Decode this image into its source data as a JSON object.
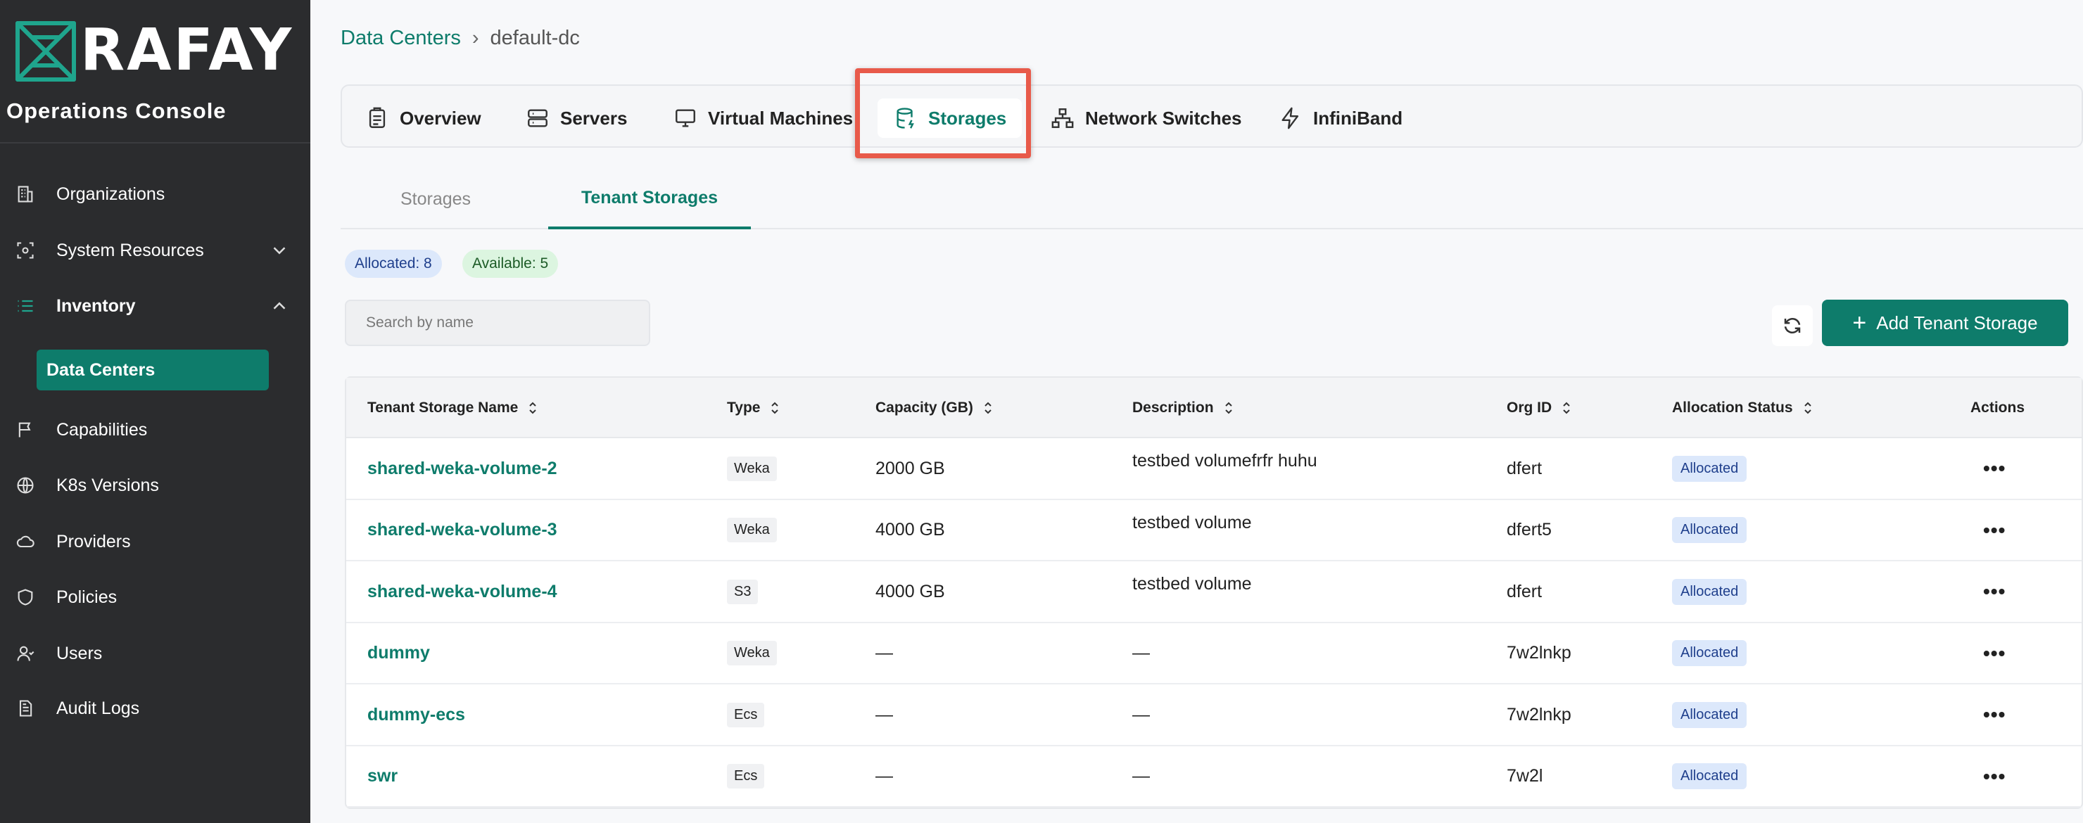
{
  "sidebar": {
    "brand": "RAFAY",
    "console_title": "Operations Console",
    "items": [
      {
        "label": "Organizations",
        "icon": "building-icon"
      },
      {
        "label": "System Resources",
        "icon": "scan-icon"
      },
      {
        "label": "Inventory",
        "icon": "list-icon"
      },
      {
        "label": "Data Centers"
      },
      {
        "label": "Capabilities",
        "icon": "flag-icon"
      },
      {
        "label": "K8s Versions",
        "icon": "globe-icon"
      },
      {
        "label": "Providers",
        "icon": "cloud-icon"
      },
      {
        "label": "Policies",
        "icon": "shield-icon"
      },
      {
        "label": "Users",
        "icon": "user-icon"
      },
      {
        "label": "Audit Logs",
        "icon": "document-icon"
      }
    ]
  },
  "breadcrumb": {
    "parent": "Data Centers",
    "separator": "›",
    "current": "default-dc"
  },
  "tabs": [
    {
      "label": "Overview",
      "icon": "clipboard-icon"
    },
    {
      "label": "Servers",
      "icon": "server-icon"
    },
    {
      "label": "Virtual Machines",
      "icon": "monitor-icon"
    },
    {
      "label": "Storages",
      "icon": "database-icon"
    },
    {
      "label": "Network Switches",
      "icon": "network-icon"
    },
    {
      "label": "InfiniBand",
      "icon": "lightning-icon"
    }
  ],
  "active_tab": "Storages",
  "subtabs": [
    {
      "label": "Storages"
    },
    {
      "label": "Tenant Storages"
    }
  ],
  "summary": {
    "allocated": "Allocated: 8",
    "available": "Available: 5"
  },
  "search": {
    "placeholder": "Search by name"
  },
  "add_button": {
    "label": "Add Tenant Storage"
  },
  "table": {
    "columns": [
      "Tenant Storage Name",
      "Type",
      "Capacity (GB)",
      "Description",
      "Org ID",
      "Allocation Status",
      "Actions"
    ],
    "rows": [
      {
        "name": "shared-weka-volume-2",
        "type": "Weka",
        "capacity": "2000 GB",
        "description": "testbed volumefrfr huhu",
        "org_id": "dfert",
        "status": "Allocated"
      },
      {
        "name": "shared-weka-volume-3",
        "type": "Weka",
        "capacity": "4000 GB",
        "description": "testbed volume",
        "org_id": "dfert5",
        "status": "Allocated"
      },
      {
        "name": "shared-weka-volume-4",
        "type": "S3",
        "capacity": "4000 GB",
        "description": "testbed volume",
        "org_id": "dfert",
        "status": "Allocated"
      },
      {
        "name": "dummy",
        "type": "Weka",
        "capacity": "—",
        "description": "—",
        "org_id": "7w2lnkp",
        "status": "Allocated"
      },
      {
        "name": "dummy-ecs",
        "type": "Ecs",
        "capacity": "—",
        "description": "—",
        "org_id": "7w2lnkp",
        "status": "Allocated"
      },
      {
        "name": "swr",
        "type": "Ecs",
        "capacity": "—",
        "description": "—",
        "org_id": "7w2l",
        "status": "Allocated"
      }
    ],
    "actions_glyph": "•••"
  },
  "colors": {
    "accent": "#0e7c6b",
    "sidebar_bg": "#2b2c2e",
    "highlight": "#e85a4a",
    "allocated_bg": "#dce8fb"
  }
}
